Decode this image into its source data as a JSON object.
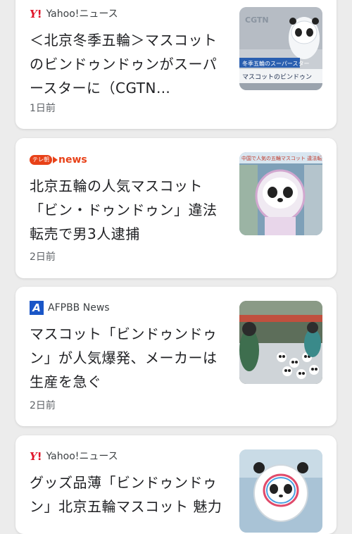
{
  "feed": {
    "cards": [
      {
        "source": "Yahoo!ニュース",
        "logo": "yahoo-logo",
        "title_lines": [
          "＜北京冬季五輪＞マスコット",
          "のビンドゥンドゥンがスーパ",
          "ースターに（CGTN…"
        ],
        "date": "1日前",
        "thumb_text": {
          "caption": "マスコットのビンドゥン",
          "banner": "冬季五輪のスーパースター",
          "logo": "CGTN"
        }
      },
      {
        "source": "news",
        "source_prefix": "テレ朝",
        "logo": "tv-asahi-logo",
        "title_lines": [
          "北京五輪の人気マスコット",
          "「ビン・ドゥンドゥン」違法",
          "転売で男3人逮捕"
        ],
        "date": "2日前",
        "thumb_text": {
          "banner": "中国で人気の五輪マスコット 違法転売"
        }
      },
      {
        "source": "AFPBB News",
        "logo": "afpbb-logo",
        "logo_letter": "A",
        "title_lines": [
          "マスコット「ビンドゥンドゥ",
          "ン」が人気爆発、メーカーは",
          "生産を急ぐ"
        ],
        "date": "2日前"
      },
      {
        "source": "Yahoo!ニュース",
        "logo": "yahoo-logo",
        "title_lines": [
          "グッズ品薄「ビンドゥンドゥ",
          "ン」北京五輪マスコット 魅力"
        ],
        "date": ""
      }
    ]
  },
  "colors": {
    "background": "#ececec",
    "card": "#ffffff",
    "yahoo_red": "#e0162b",
    "tv_asahi_orange": "#e84118",
    "afp_blue": "#1a56c7"
  }
}
